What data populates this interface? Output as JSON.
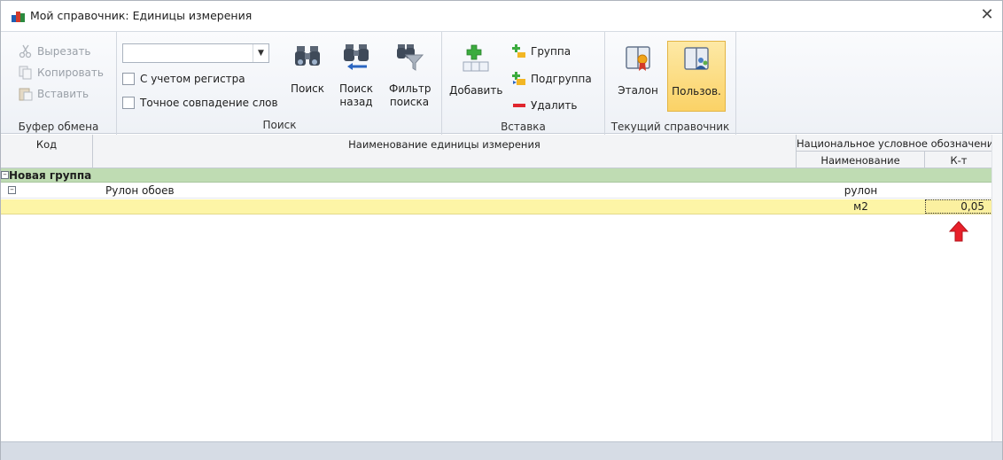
{
  "window": {
    "title": "Мой справочник: Единицы  измерения",
    "close_glyph": "✕"
  },
  "ribbon": {
    "clipboard": {
      "caption": "Буфер обмена",
      "cut": "Вырезать",
      "copy": "Копировать",
      "paste": "Вставить"
    },
    "search": {
      "caption": "Поиск",
      "combo_value": "",
      "case_sensitive": "С учетом регистра",
      "exact_match": "Точное совпадение слов",
      "find": "Поиск",
      "find_back_line1": "Поиск",
      "find_back_line2": "назад",
      "filter_line1": "Фильтр",
      "filter_line2": "поиска"
    },
    "insert": {
      "caption": "Вставка",
      "add": "Добавить",
      "group": "Группа",
      "subgroup": "Подгруппа",
      "delete": "Удалить"
    },
    "current": {
      "caption": "Текущий справочник",
      "standard": "Эталон",
      "user": "Пользов."
    }
  },
  "grid": {
    "headers": {
      "code": "Код",
      "name": "Наименование единицы измерения",
      "national": "Национальное условное обозначение",
      "nat_name": "Наименование",
      "coef": "К-т"
    },
    "group_row": {
      "label": "Новая группа"
    },
    "rows": [
      {
        "code": "",
        "name": "Рулон обоев",
        "nat_name": "рулон",
        "coef": ""
      },
      {
        "code": "",
        "name": "",
        "nat_name": "м2",
        "coef": "0,05"
      }
    ]
  },
  "colors": {
    "group_row": "#bfdcb3",
    "selected_row": "#fdf5a6",
    "pressed_button": "#fbd266",
    "arrow": "#e8202a"
  }
}
